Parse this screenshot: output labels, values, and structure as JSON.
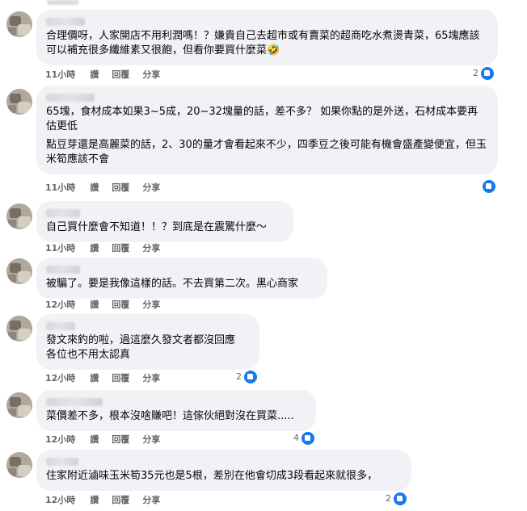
{
  "labels": {
    "like": "讚",
    "reply": "回覆",
    "share": "分享"
  },
  "comments": [
    {
      "text": "合理價呀，人家開店不用利潤嗎！？嫌貴自己去超市或有賣菜的超商吃水煮燙青菜，65塊應該可以補充很多纖維素又很飽，但看你要買什麼菜🤣",
      "time": "11小時",
      "reactions": "2"
    },
    {
      "text": "65塊，食材成本如果3~5成，20~32塊量的話，差不多？ 如果你點的是外送，石材成本要再估更低",
      "text2": "點豆芽還是高麗菜的話，2、30的量才會看起來不少，四季豆之後可能有機會盛產變便宜，但玉米筍應該不會",
      "time": "11小時",
      "reactions": ""
    },
    {
      "text": "自己買什麼會不知道！！？到底是在震驚什麼～",
      "time": "11小時",
      "reactions": ""
    },
    {
      "text": "被騙了。要是我像這樣的話。不去買第二次。黑心商家",
      "time": "12小時",
      "reactions": ""
    },
    {
      "text": "發文來釣的啦，過這麼久發文者都沒回應\n各位也不用太認真",
      "time": "12小時",
      "reactions": "2"
    },
    {
      "text": "菜價差不多，根本沒啥賺吧！這傢伙絕對沒在買菜.....",
      "time": "12小時",
      "reactions": "4"
    },
    {
      "text": "住家附近滷味玉米筍35元也是5根，差別在他會切成3段看起來就很多，",
      "time": "12小時",
      "reactions": "2"
    }
  ]
}
